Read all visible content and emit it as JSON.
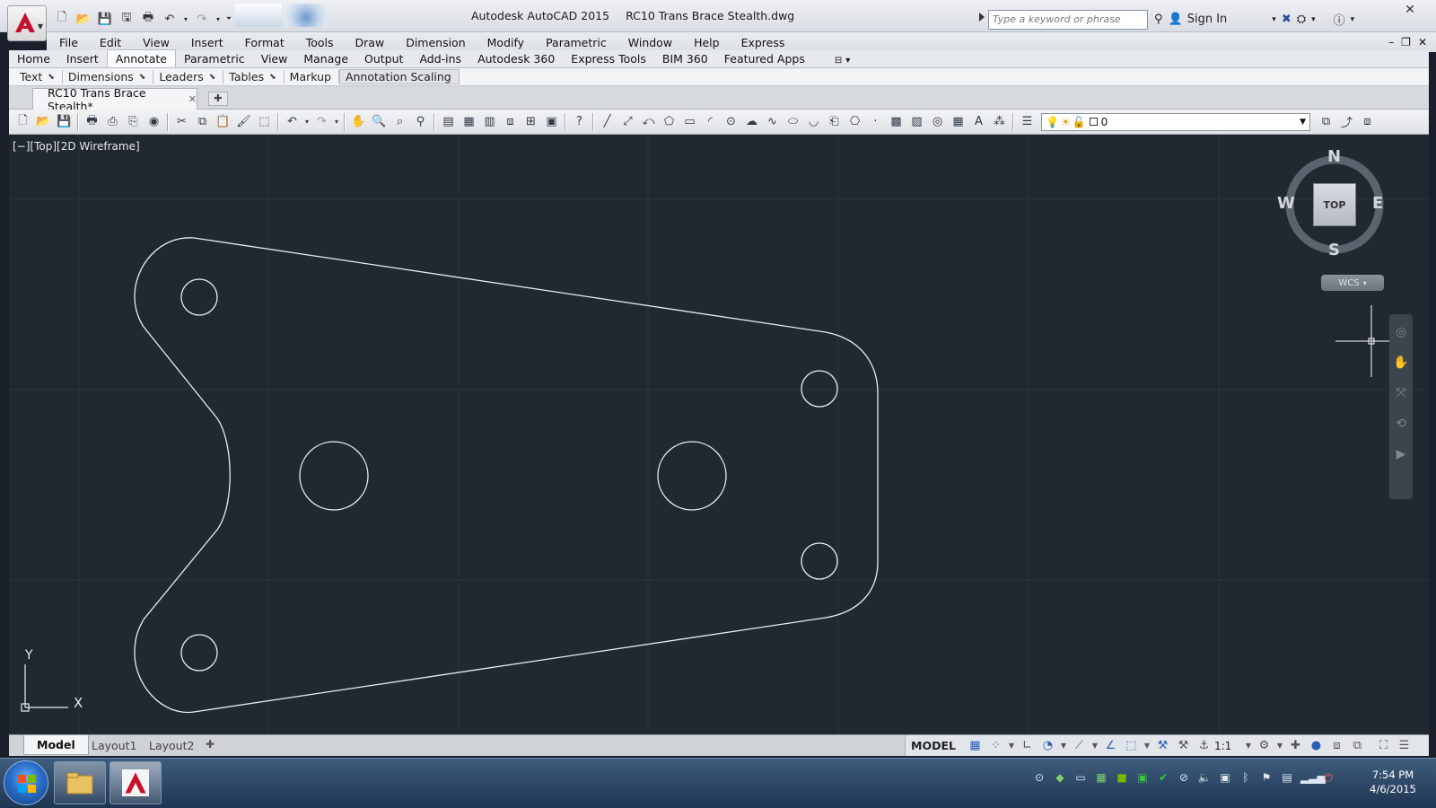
{
  "app": {
    "product": "Autodesk AutoCAD 2015",
    "document": "RC10 Trans Brace Stealth.dwg",
    "search_placeholder": "Type a keyword or phrase",
    "signin_label": "Sign In"
  },
  "menubar": {
    "items": [
      "File",
      "Edit",
      "View",
      "Insert",
      "Format",
      "Tools",
      "Draw",
      "Dimension",
      "Modify",
      "Parametric",
      "Window",
      "Help",
      "Express"
    ]
  },
  "ribbon": {
    "tabs": [
      "Home",
      "Insert",
      "Annotate",
      "Parametric",
      "View",
      "Manage",
      "Output",
      "Add-ins",
      "Autodesk 360",
      "Express Tools",
      "BIM 360",
      "Featured Apps"
    ],
    "active_tab": "Annotate",
    "panels": [
      "Text",
      "Dimensions",
      "Leaders",
      "Tables",
      "Markup",
      "Annotation Scaling"
    ]
  },
  "file_tab": {
    "label": "RC10 Trans Brace Stealth*"
  },
  "toolbar": {
    "layer_value": "0"
  },
  "viewport": {
    "label": "[−][Top][2D Wireframe]",
    "viewcube": {
      "top": "TOP",
      "n": "N",
      "s": "S",
      "e": "E",
      "w": "W"
    },
    "wcs_label": "WCS",
    "ucs_x": "X",
    "ucs_y": "Y"
  },
  "layout_tabs": {
    "items": [
      "Model",
      "Layout1",
      "Layout2"
    ],
    "active": "Model"
  },
  "statusbar": {
    "space": "MODEL",
    "scale": "1:1"
  },
  "taskbar": {
    "time": "7:54 PM",
    "date": "4/6/2015"
  },
  "colors": {
    "canvas": "#212830",
    "geometry": "#ffffff",
    "accent_red": "#c8102e"
  }
}
